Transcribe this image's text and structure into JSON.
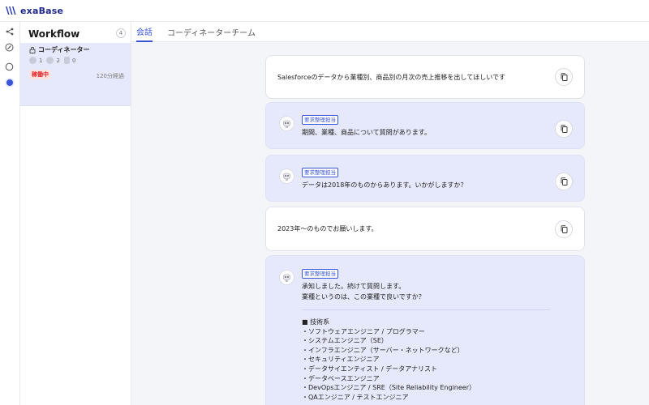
{
  "app": {
    "logo_text": "exaBase",
    "brand_color": "#1f2a8a",
    "accent_color": "#3a56d6"
  },
  "rail": {
    "icons": [
      "share-icon",
      "compass-icon",
      "circle-icon",
      "dot-icon"
    ]
  },
  "workflow": {
    "title": "Workflow",
    "count": "4",
    "item": {
      "name": "コーディネーター",
      "stat1": "1",
      "stat2": "2",
      "stat3": "0",
      "status": "稼働中",
      "elapsed": "120分経過"
    }
  },
  "tabs": [
    {
      "label": "会話",
      "active": true
    },
    {
      "label": "コーディネーターチーム",
      "active": false
    }
  ],
  "messages": [
    {
      "type": "user",
      "text": "Salesforceのデータから業種別、商品別の月次の売上推移を出してほしいです"
    },
    {
      "type": "bot",
      "role": "要求整理担当",
      "text": "期間、業種、商品について質問があります。"
    },
    {
      "type": "bot",
      "role": "要求整理担当",
      "text": "データは2018年のものからあります。いかがしますか？"
    },
    {
      "type": "user",
      "text": "2023年〜のものでお願いします。"
    },
    {
      "type": "bot",
      "role": "要求整理担当",
      "line1": "承知しました。続けて質問します。",
      "line2": "業種というのは、この業種で良いですか？",
      "list": [
        "■ 技術系",
        "・ソフトウェアエンジニア / プログラマー",
        "・システムエンジニア（SE）",
        "・インフラエンジニア（サーバー・ネットワークなど）",
        "・セキュリティエンジニア",
        "・データサイエンティスト / データアナリスト",
        "・データベースエンジニア",
        "・DevOpsエンジニア / SRE（Site Reliability Engineer）",
        "・QAエンジニア / テストエンジニア"
      ]
    }
  ]
}
